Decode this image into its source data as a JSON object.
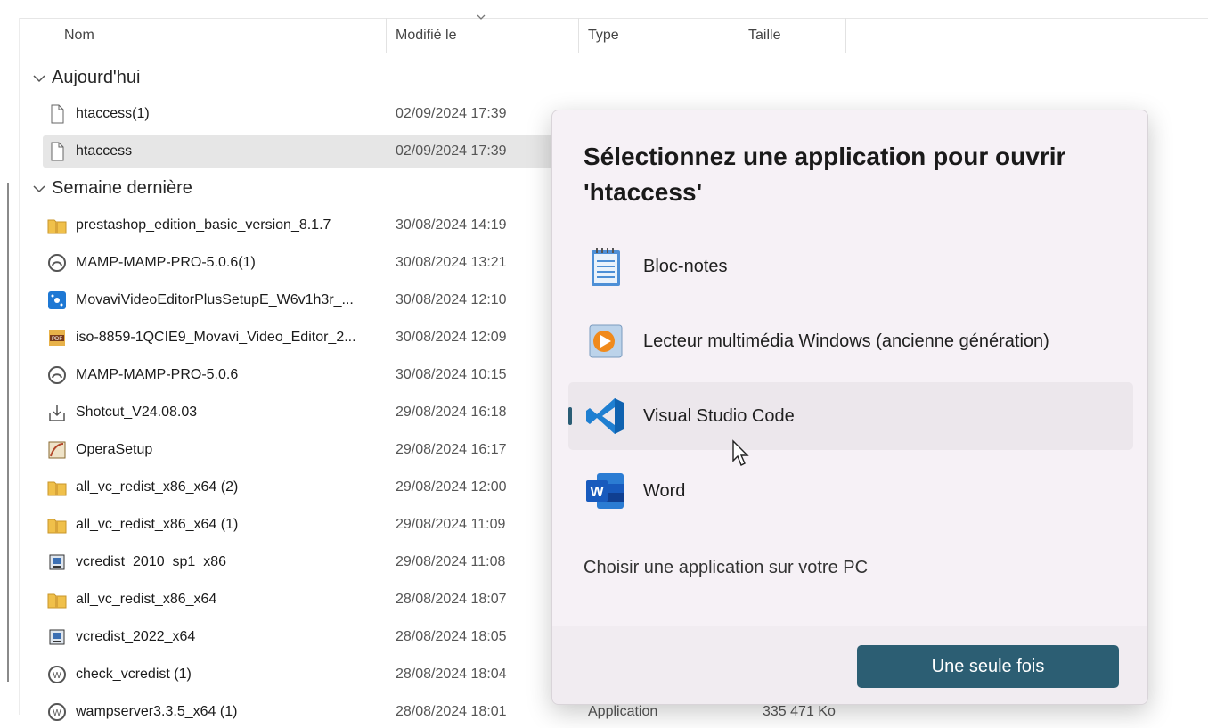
{
  "columns": {
    "name": "Nom",
    "modified": "Modifié le",
    "type": "Type",
    "size": "Taille"
  },
  "groups": {
    "today": "Aujourd'hui",
    "last_week": "Semaine dernière"
  },
  "files": [
    {
      "name": "htaccess(1)",
      "date": "02/09/2024 17:39",
      "icon": "document-icon"
    },
    {
      "name": "htaccess",
      "date": "02/09/2024 17:39",
      "icon": "document-icon",
      "selected": true
    },
    {
      "name": "prestashop_edition_basic_version_8.1.7",
      "date": "30/08/2024 14:19",
      "icon": "zip-folder-icon"
    },
    {
      "name": "MAMP-MAMP-PRO-5.0.6(1)",
      "date": "30/08/2024 13:21",
      "icon": "mamp-icon"
    },
    {
      "name": "MovaviVideoEditorPlusSetupE_W6v1h3r_...",
      "date": "30/08/2024 12:10",
      "icon": "movavi-icon"
    },
    {
      "name": "iso-8859-1QCIE9_Movavi_Video_Editor_2...",
      "date": "30/08/2024 12:09",
      "icon": "pdf-icon"
    },
    {
      "name": "MAMP-MAMP-PRO-5.0.6",
      "date": "30/08/2024 10:15",
      "icon": "mamp-icon"
    },
    {
      "name": "Shotcut_V24.08.03",
      "date": "29/08/2024 16:18",
      "icon": "installer-icon"
    },
    {
      "name": "OperaSetup",
      "date": "29/08/2024 16:17",
      "icon": "opera-setup-icon"
    },
    {
      "name": "all_vc_redist_x86_x64 (2)",
      "date": "29/08/2024 12:00",
      "icon": "zip-folder-icon"
    },
    {
      "name": "all_vc_redist_x86_x64 (1)",
      "date": "29/08/2024 11:09",
      "icon": "zip-folder-icon"
    },
    {
      "name": "vcredist_2010_sp1_x86",
      "date": "29/08/2024 11:08",
      "icon": "setup-icon"
    },
    {
      "name": "all_vc_redist_x86_x64",
      "date": "28/08/2024 18:07",
      "icon": "zip-folder-icon"
    },
    {
      "name": "vcredist_2022_x64",
      "date": "28/08/2024 18:05",
      "icon": "setup-icon"
    },
    {
      "name": "check_vcredist (1)",
      "date": "28/08/2024 18:04",
      "icon": "wamp-icon"
    },
    {
      "name": "wampserver3.3.5_x64 (1)",
      "date": "28/08/2024 18:01",
      "icon": "wamp-icon",
      "type": "Application",
      "size": "335 471 Ko"
    }
  ],
  "dialog": {
    "title": "Sélectionnez une application pour ouvrir 'htaccess'",
    "apps": [
      {
        "label": "Bloc-notes",
        "icon": "notepad-icon"
      },
      {
        "label": "Lecteur multimédia Windows (ancienne génération)",
        "icon": "media-player-icon"
      },
      {
        "label": "Visual Studio Code",
        "icon": "vscode-icon",
        "hovered": true
      },
      {
        "label": "Word",
        "icon": "word-icon"
      }
    ],
    "choose_link": "Choisir une application sur votre PC",
    "once_button": "Une seule fois"
  },
  "colors": {
    "accent": "#2c5e73",
    "dialog_bg": "#f6f1f6",
    "selected_row": "#e6e6e6"
  }
}
